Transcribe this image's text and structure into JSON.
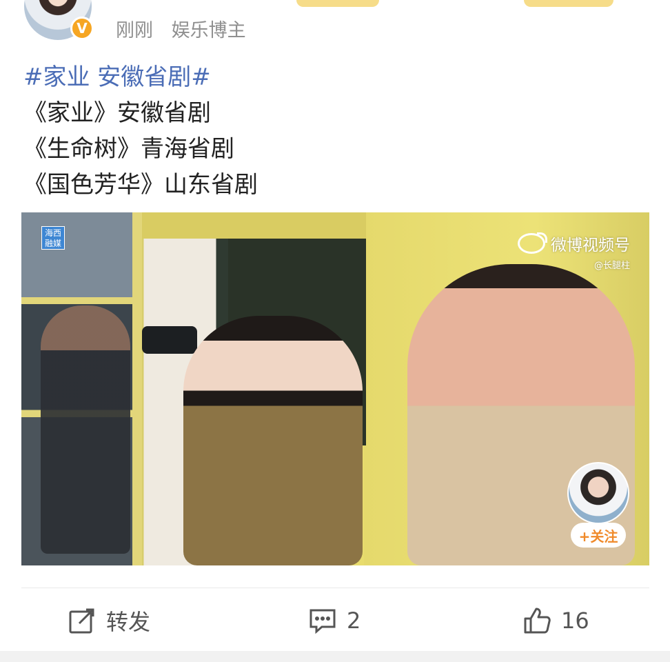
{
  "post": {
    "time": "刚刚",
    "author_tag": "娱乐博主",
    "verified_badge": "V",
    "topic": "#家业 安徽省剧#",
    "lines": [
      "《家业》安徽省剧",
      "《生命树》青海省剧",
      "《国色芳华》山东省剧"
    ]
  },
  "video": {
    "logo_text": "海西融媒",
    "watermark_title": "微博视频号",
    "watermark_handle": "@长腿柱",
    "follow_label": "+关注"
  },
  "actions": {
    "repost_label": "转发",
    "comment_count": "2",
    "like_count": "16"
  },
  "colors": {
    "topic_link": "#4b6db6",
    "badge": "#f6a623",
    "follow_text": "#f08a2a"
  },
  "icons": [
    "verified-icon",
    "repost-icon",
    "comment-icon",
    "like-icon",
    "weibo-logo-icon"
  ]
}
